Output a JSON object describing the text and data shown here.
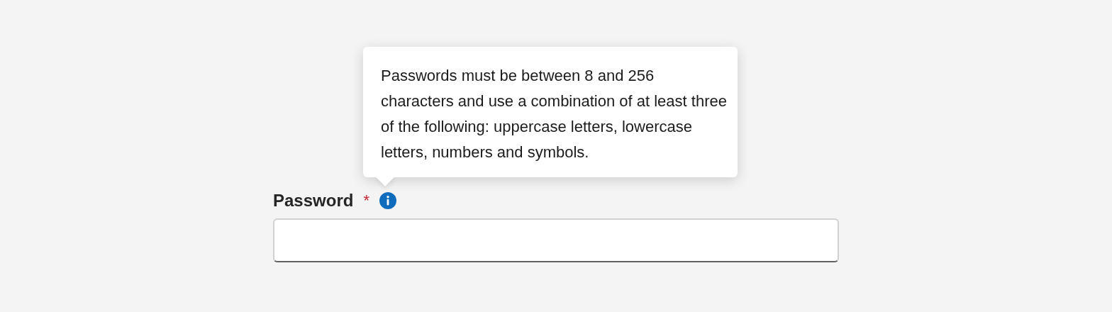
{
  "tooltip": {
    "text": "Passwords must be between 8 and 256 characters and use a combination of at least three of the following: uppercase letters, lowercase letters, numbers and symbols."
  },
  "field": {
    "label": "Password",
    "required_mark": "*"
  }
}
